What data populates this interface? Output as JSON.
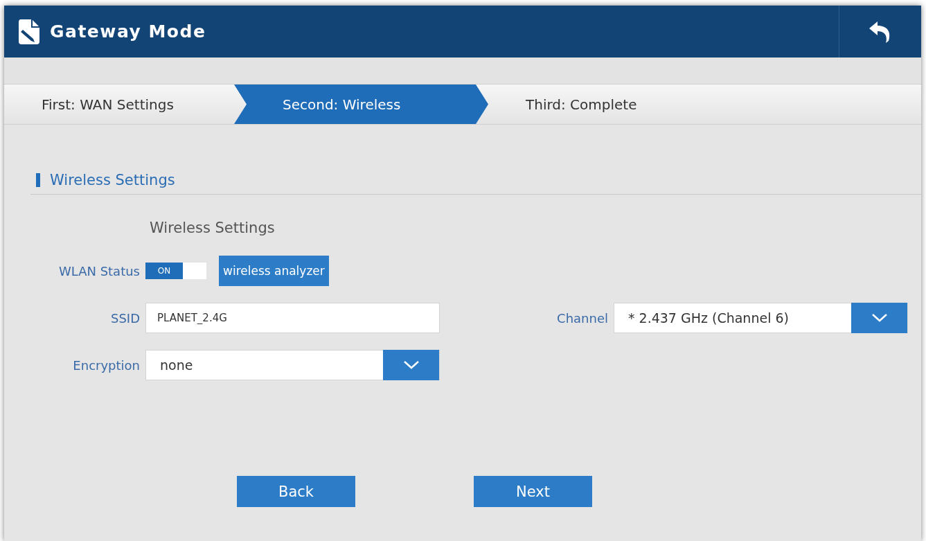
{
  "window": {
    "title": "Gateway Mode"
  },
  "steps": [
    {
      "label": "First: WAN Settings",
      "selected": false
    },
    {
      "label": "Second: Wireless",
      "selected": true
    },
    {
      "label": "Third: Complete",
      "selected": false
    }
  ],
  "section": {
    "title": "Wireless Settings",
    "subtitle": "Wireless Settings"
  },
  "wlan_status": {
    "label": "WLAN Status",
    "toggle_text": "ON",
    "on": true,
    "analyzer_button": "wireless analyzer"
  },
  "ssid": {
    "label": "SSID",
    "value": "PLANET_2.4G"
  },
  "channel": {
    "label": "Channel",
    "value": "* 2.437 GHz (Channel 6)"
  },
  "encryption": {
    "label": "Encryption",
    "value": "none"
  },
  "buttons": [
    "Back",
    "Next"
  ]
}
